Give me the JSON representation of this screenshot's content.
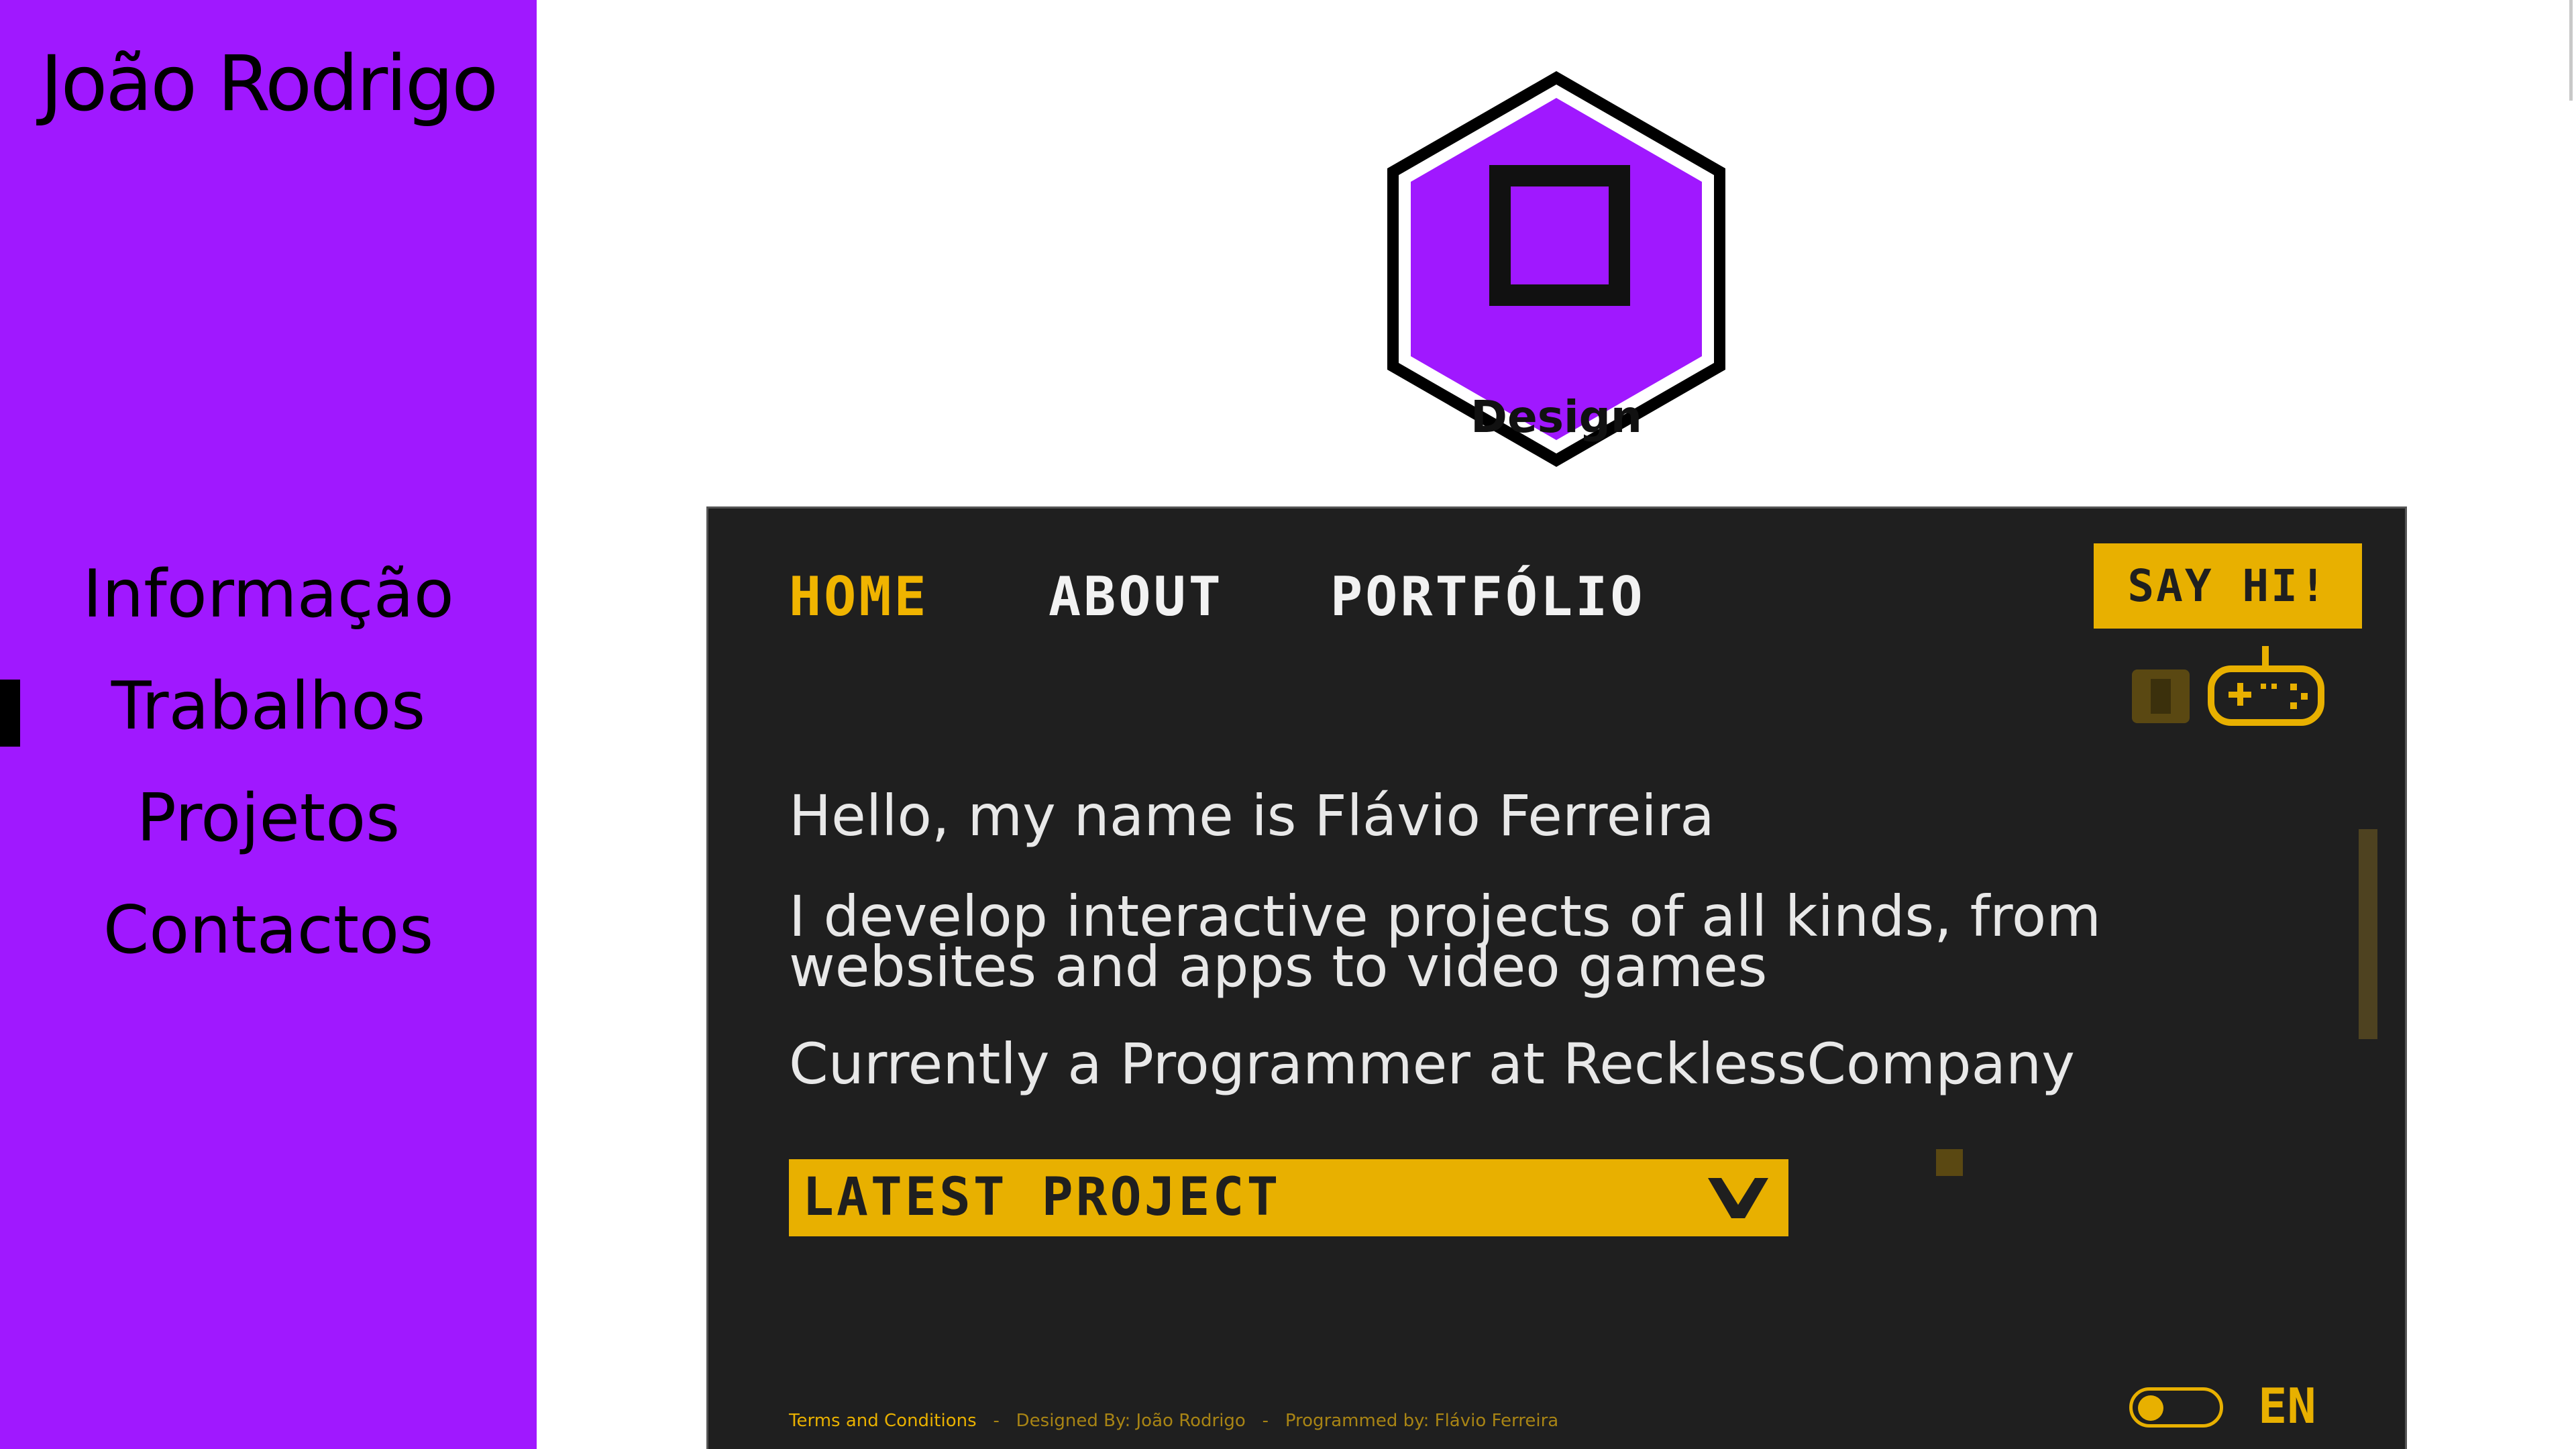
{
  "sidebar": {
    "title": "João Rodrigo",
    "items": [
      {
        "label": "Informação"
      },
      {
        "label": "Trabalhos",
        "active": true
      },
      {
        "label": "Projetos"
      },
      {
        "label": "Contactos"
      }
    ]
  },
  "badge": {
    "label": "Design",
    "icon": "square-outline-icon"
  },
  "preview": {
    "nav": [
      {
        "label": "HOME",
        "active": true
      },
      {
        "label": "ABOUT"
      },
      {
        "label": "PORTFÓLIO"
      }
    ],
    "cta_label": "SAY HI!",
    "icons": [
      "block-icon",
      "gamepad-icon"
    ],
    "intro": "Hello, my name is Flávio Ferreira",
    "description_line1": "I develop interactive projects of all kinds, from",
    "description_line2": "websites and apps to video games",
    "role": "Currently a Programmer at RecklessCompany",
    "latest_label": "LATEST PROJECT",
    "footer": {
      "terms": "Terms and Conditions",
      "designed": "Designed By: João Rodrigo",
      "programmed": "Programmed by: Flávio Ferreira",
      "separator": "-"
    },
    "language": "EN"
  },
  "colors": {
    "sidebar_bg": "#a018ff",
    "preview_bg": "#1f1f1f",
    "accent": "#e8b000"
  }
}
